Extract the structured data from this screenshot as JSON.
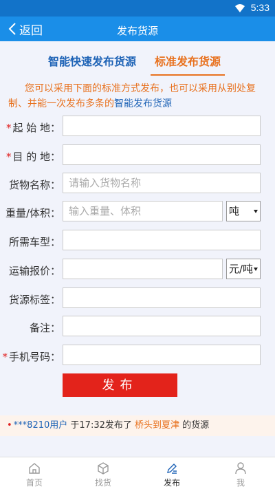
{
  "status": {
    "time": "5:33"
  },
  "header": {
    "back_label": "返回",
    "title": "发布货源"
  },
  "tabs": {
    "smart": "智能快速发布货源",
    "standard": "标准发布货源"
  },
  "intro": {
    "text": "您可以采用下面的标准方式发布，也可以采用从别处复制、并能一次发布多条的",
    "link": "智能发布货源"
  },
  "form": {
    "origin": {
      "label": "起 始 地：",
      "value": ""
    },
    "destination": {
      "label": "目 的 地：",
      "value": ""
    },
    "cargo_name": {
      "label": "货物名称：",
      "placeholder": "请输入货物名称"
    },
    "weight": {
      "label": "重量/体积：",
      "placeholder": "输入重量、体积",
      "unit": "吨"
    },
    "vehicle": {
      "label": "所需车型：",
      "value": ""
    },
    "price": {
      "label": "运输报价：",
      "value": "",
      "unit": "元/吨"
    },
    "tags": {
      "label": "货源标签：",
      "value": ""
    },
    "remark": {
      "label": "备注：",
      "value": ""
    },
    "phone": {
      "label": "手机号码：",
      "value": ""
    },
    "required_mark": "*",
    "submit": "发布"
  },
  "ticker": {
    "user": "***8210用户",
    "text1": " 于17:32发布了 ",
    "route": "桥头到夏津",
    "text2": " 的货源"
  },
  "nav": [
    {
      "label": "首页",
      "icon": "home-icon"
    },
    {
      "label": "找货",
      "icon": "box-icon"
    },
    {
      "label": "发布",
      "icon": "edit-icon"
    },
    {
      "label": "我",
      "icon": "person-icon"
    }
  ],
  "colors": {
    "primary": "#1a8ee8",
    "accent": "#e8711e",
    "link": "#1e63b6",
    "submit": "#e3231b"
  }
}
